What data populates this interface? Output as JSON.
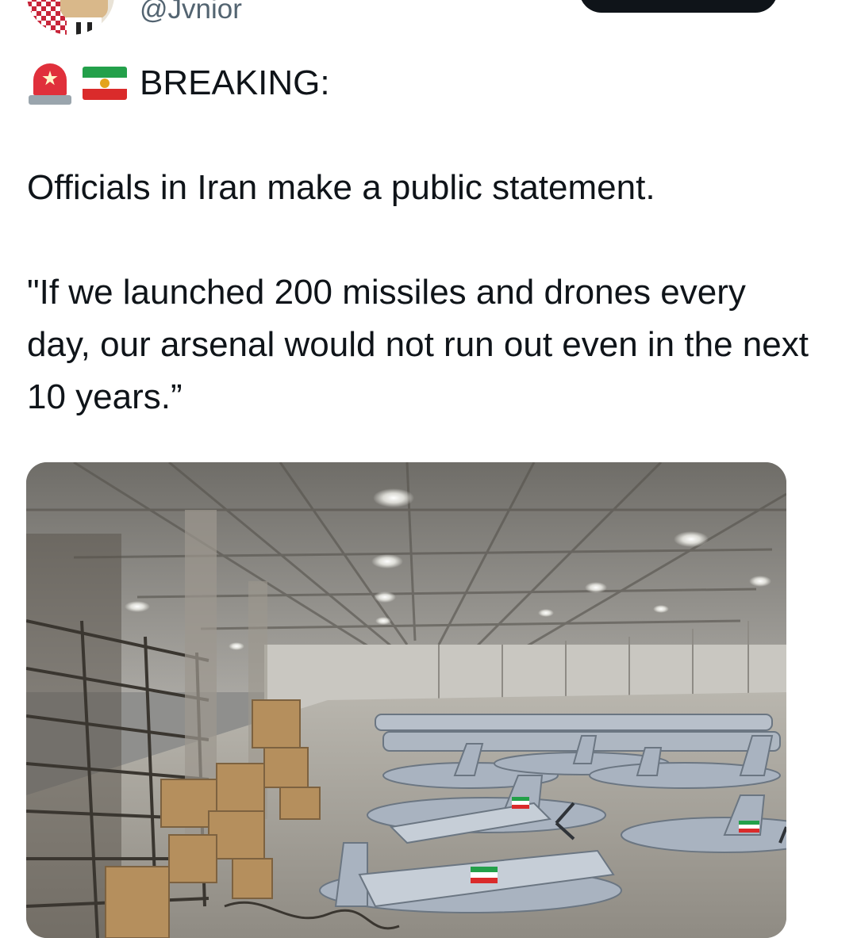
{
  "author": {
    "handle": "@Jvnior"
  },
  "tweet": {
    "headline_emojis": [
      "rotating-light-icon",
      "iran-lion-sun-flag-icon"
    ],
    "headline": "BREAKING:",
    "statement": "Officials in Iran make a public statement.",
    "quote": "\"If we launched 200 missiles and drones every day, our arsenal would not run out even in the next 10 years.”"
  },
  "media": {
    "type": "photo",
    "subject": "warehouse-with-rows-of-drones"
  },
  "colors": {
    "text": "#0f1419",
    "handle": "#536471",
    "button": "#0f1419"
  }
}
